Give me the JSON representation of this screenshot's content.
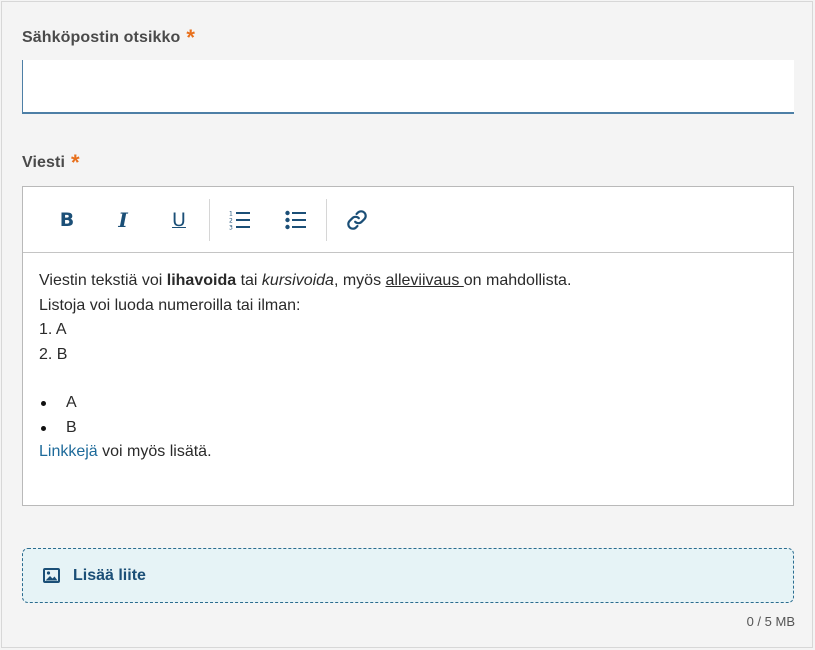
{
  "subject": {
    "label": "Sähköpostin otsikko",
    "required_mark": "*",
    "value": "",
    "placeholder": ""
  },
  "message": {
    "label": "Viesti",
    "required_mark": "*",
    "toolbar": {
      "bold": "B",
      "italic": "I",
      "underline": "U",
      "ordered_list_icon": "ordered-list-icon",
      "bullet_list_icon": "bullet-list-icon",
      "link_icon": "link-icon"
    },
    "body": {
      "line1": {
        "t1": "Viestin tekstiä voi ",
        "bold": "lihavoida",
        "t2": " tai ",
        "italic": "kursivoida",
        "t3": ", myös ",
        "underline": "alleviivaus ",
        "t4": "on mahdollista."
      },
      "line2": "Listoja voi luoda numeroilla tai ilman:",
      "ordered": [
        "1. A",
        "2. B"
      ],
      "bullets": [
        "A",
        "B"
      ],
      "link_line": {
        "link": "Linkkejä",
        "rest": " voi myös lisätä."
      }
    }
  },
  "attachment": {
    "icon": "image-icon",
    "label": "Lisää liite",
    "size_info": "0 / 5 MB"
  },
  "colors": {
    "accent": "#1b4f77",
    "required": "#e8701c",
    "attach_bg": "#e6f3f6"
  }
}
